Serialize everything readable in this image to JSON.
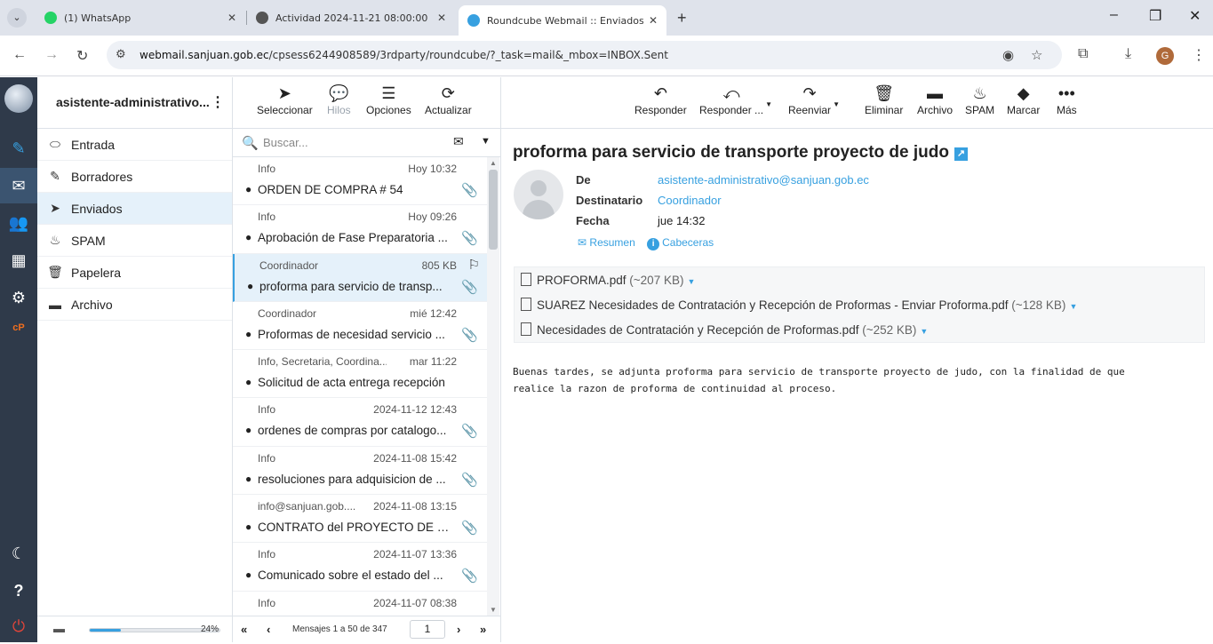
{
  "browser": {
    "tabs": [
      {
        "label": "(1) WhatsApp",
        "color": "#25d366"
      },
      {
        "label": "Actividad 2024-11-21 08:00:00",
        "color": "#555555"
      },
      {
        "label": "Roundcube Webmail :: Enviados",
        "color": "#37a0e0"
      }
    ],
    "url_host": "webmail.sanjuan.gob.ec",
    "url_path": "/cpsess6244908589/3rdparty/roundcube/?_task=mail&_mbox=INBOX.Sent",
    "profile_initial": "G"
  },
  "app": {
    "account": "asistente-administrativo...",
    "folders": [
      {
        "label": "Entrada",
        "icon": "inbox-icon"
      },
      {
        "label": "Borradores",
        "icon": "pencil-icon"
      },
      {
        "label": "Enviados",
        "icon": "paper-plane-icon"
      },
      {
        "label": "SPAM",
        "icon": "fire-icon"
      },
      {
        "label": "Papelera",
        "icon": "trash-icon"
      },
      {
        "label": "Archivo",
        "icon": "archive-icon"
      }
    ],
    "quota": {
      "text": "24%",
      "fraction": 0.24
    },
    "list_toolbar": {
      "select": "Seleccionar",
      "threads": "Hilos",
      "options": "Opciones",
      "refresh": "Actualizar"
    },
    "search_placeholder": "Buscar...",
    "messages": [
      {
        "from": "Info",
        "date": "Hoy 10:32",
        "subject": "ORDEN DE COMPRA # 54"
      },
      {
        "from": "Info",
        "date": "Hoy 09:26",
        "subject": "Aprobación de Fase Preparatoria ..."
      },
      {
        "from": "Coordinador",
        "date": "805 KB",
        "subject": "proforma para servicio de transp..."
      },
      {
        "from": "Coordinador",
        "date": "mié 12:42",
        "subject": "Proformas de necesidad servicio ..."
      },
      {
        "from": "Info, Secretaria, Coordina...",
        "date": "mar 11:22",
        "subject": "Solicitud de acta entrega recepción"
      },
      {
        "from": "Info",
        "date": "2024-11-12 12:43",
        "subject": "ordenes de compras por catalogo..."
      },
      {
        "from": "Info",
        "date": "2024-11-08 15:42",
        "subject": "resoluciones para adquisicion de ..."
      },
      {
        "from": "info@sanjuan.gob....",
        "date": "2024-11-08 13:15",
        "subject": "CONTRATO del PROYECTO DE RE..."
      },
      {
        "from": "Info",
        "date": "2024-11-07 13:36",
        "subject": "Comunicado sobre el estado del ..."
      },
      {
        "from": "Info",
        "date": "2024-11-07 08:38",
        "subject": ""
      }
    ],
    "pagination": {
      "text": "Mensajes 1 a 50 de 347",
      "page": "1"
    },
    "reader_toolbar": {
      "reply": "Responder",
      "reply_all": "Responder ...",
      "forward": "Reenviar",
      "delete": "Eliminar",
      "archive": "Archivo",
      "spam": "SPAM",
      "mark": "Marcar",
      "more": "Más"
    },
    "message": {
      "subject": "proforma para servicio de transporte proyecto de judo",
      "from_label": "De",
      "from": "asistente-administrativo@sanjuan.gob.ec",
      "to_label": "Destinatario",
      "to": "Coordinador",
      "date_label": "Fecha",
      "date": "jue 14:32",
      "summary_link": "Resumen",
      "headers_link": "Cabeceras",
      "attachments": [
        {
          "name": "PROFORMA.pdf",
          "size": "(~207 KB)"
        },
        {
          "name": "SUAREZ Necesidades de Contratación y Recepción de Proformas - Enviar Proforma.pdf",
          "size": "(~128 KB)"
        },
        {
          "name": "Necesidades de Contratación y Recepción de Proformas.pdf",
          "size": "(~252 KB)"
        }
      ],
      "body_line1": "Buenas tardes, se adjunta proforma para servicio de transporte proyecto de judo, con la finalidad de que",
      "body_line2": "realice la razon de proforma de continuidad al proceso."
    }
  }
}
